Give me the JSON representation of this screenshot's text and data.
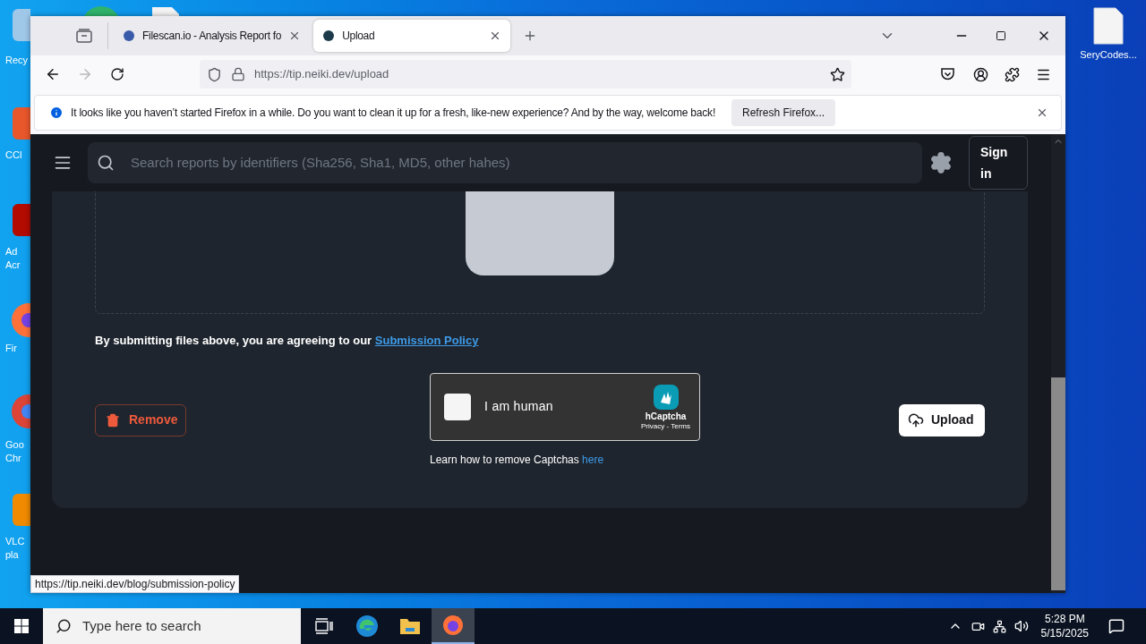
{
  "desktop_icons": [
    {
      "kind": "recycle",
      "lines": [
        "Recy"
      ]
    },
    {
      "kind": "ccleaner",
      "lines": [
        "CCl"
      ]
    },
    {
      "kind": "acrobat",
      "lines": [
        "Ad",
        "Acr"
      ]
    },
    {
      "kind": "firefox",
      "lines": [
        "Fir"
      ]
    },
    {
      "kind": "chrome",
      "lines": [
        "Goo",
        "Chr"
      ]
    },
    {
      "kind": "vlc",
      "lines": [
        "VLC",
        "pla"
      ]
    },
    {
      "kind": "file",
      "lines": [
        "SeryCodes..."
      ]
    }
  ],
  "browser": {
    "tabs": [
      {
        "title": "Filescan.io - Analysis Report fo",
        "selected": false
      },
      {
        "title": "Upload",
        "selected": true
      }
    ],
    "forward_disabled": true,
    "url": "https://tip.neiki.dev/upload",
    "notification": {
      "message": "It looks like you haven’t started Firefox in a while. Do you want to clean it up for a fresh, like-new experience? And by the way, welcome back!",
      "button": "Refresh Firefox..."
    },
    "status_link": "https://tip.neiki.dev/blog/submission-policy"
  },
  "page": {
    "search": {
      "placeholder": "Search reports by identifiers (Sha256, Sha1, MD5, other hahes)"
    },
    "sign_in": "Sign in",
    "policy": {
      "text": "By submitting files above, you are agreeing to our",
      "link": "Submission Policy"
    },
    "remove_button": "Remove",
    "captcha": {
      "checked": false,
      "label": "I am human",
      "brand": "hCaptcha",
      "links": "Privacy - Terms"
    },
    "captcha_help": {
      "text": "Learn how to remove Captchas",
      "link": "here"
    },
    "upload_button": "Upload"
  },
  "taskbar": {
    "search_placeholder": "Type here to search",
    "apps": [
      {
        "kind": "taskview",
        "selected": false
      },
      {
        "kind": "edge",
        "selected": false
      },
      {
        "kind": "explorer",
        "selected": false
      },
      {
        "kind": "firefox",
        "selected": true
      }
    ],
    "time": "5:28 PM",
    "date": "5/15/2025"
  }
}
